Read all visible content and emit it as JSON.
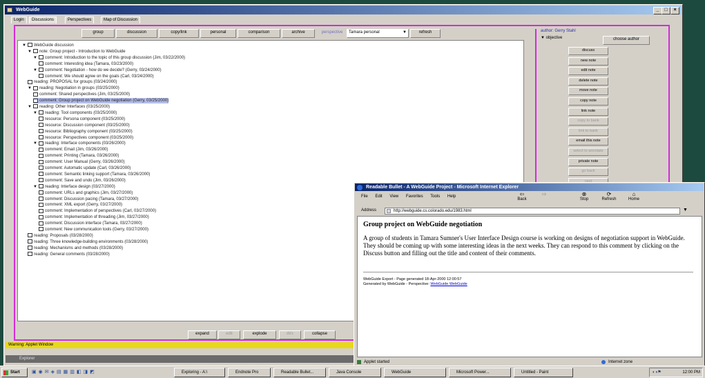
{
  "app_window": {
    "title": "WebGuide",
    "tabs": [
      "Login",
      "Discussions",
      "Perspectives",
      "Map of Discussion"
    ],
    "toolbar": {
      "buttons": [
        "group",
        "discussion",
        "copy/link",
        "personal",
        "comparison",
        "archive",
        "perspective"
      ],
      "perspective_value": "Tamara personal",
      "refresh_label": "refresh"
    },
    "tree": [
      {
        "indent": 0,
        "expander": "down",
        "text": "WebGuide discussion",
        "selected": false
      },
      {
        "indent": 1,
        "expander": "down",
        "text": "note: Group project - Introduction to WebGuide",
        "selected": false
      },
      {
        "indent": 2,
        "expander": "down",
        "text": "comment: Introduction to the topic of this group discussion (Jim, 03/22/2000)",
        "selected": false
      },
      {
        "indent": 3,
        "expander": "",
        "text": "comment: Interesting idea (Tamara, 03/23/2000)",
        "selected": false
      },
      {
        "indent": 2,
        "expander": "down",
        "text": "comment: Negotiation - how do we decide? (Gerry, 03/24/2000)",
        "selected": false
      },
      {
        "indent": 3,
        "expander": "",
        "text": "comment: We should agree on the goals (Carl, 03/24/2000)",
        "selected": false
      },
      {
        "indent": 1,
        "expander": "",
        "text": "reading: PROPOSAL for groups (03/24/2000)",
        "selected": false
      },
      {
        "indent": 1,
        "expander": "down",
        "text": "reading: Negotiation in groups (03/25/2000)",
        "selected": false
      },
      {
        "indent": 2,
        "expander": "",
        "text": "comment: Shared perspectives (Jim, 03/25/2000)",
        "selected": false
      },
      {
        "indent": 2,
        "expander": "",
        "text": "comment: Group project on WebGuide negotiation (Gerry, 03/25/2000)",
        "selected": true
      },
      {
        "indent": 1,
        "expander": "down",
        "text": "reading: Other Interfaces (03/25/2000)",
        "selected": false
      },
      {
        "indent": 2,
        "expander": "down",
        "text": "reading: Tool components (03/25/2000)",
        "selected": false
      },
      {
        "indent": 3,
        "expander": "",
        "text": "resource: Persona component (03/25/2000)",
        "selected": false
      },
      {
        "indent": 3,
        "expander": "",
        "text": "resource: Discussion component (03/25/2000)",
        "selected": false
      },
      {
        "indent": 3,
        "expander": "",
        "text": "resource: Bibliography component (03/25/2000)",
        "selected": false
      },
      {
        "indent": 3,
        "expander": "",
        "text": "resource: Perspectives component (03/25/2000)",
        "selected": false
      },
      {
        "indent": 2,
        "expander": "down",
        "text": "reading: Interface components (03/26/2000)",
        "selected": false
      },
      {
        "indent": 3,
        "expander": "",
        "text": "comment: Email (Jim, 03/26/2000)",
        "selected": false
      },
      {
        "indent": 3,
        "expander": "",
        "text": "comment: Printing (Tamara, 03/26/2000)",
        "selected": false
      },
      {
        "indent": 3,
        "expander": "",
        "text": "comment: User Manual (Gerry, 03/26/2000)",
        "selected": false
      },
      {
        "indent": 3,
        "expander": "",
        "text": "comment: Automatic update (Carl, 03/26/2000)",
        "selected": false
      },
      {
        "indent": 3,
        "expander": "",
        "text": "comment: Semantic linking support (Tamara, 03/26/2000)",
        "selected": false
      },
      {
        "indent": 3,
        "expander": "",
        "text": "comment: Save and undo (Jim, 03/26/2000)",
        "selected": false
      },
      {
        "indent": 2,
        "expander": "down",
        "text": "reading: Interface design (03/27/2000)",
        "selected": false
      },
      {
        "indent": 3,
        "expander": "",
        "text": "comment: URLs and graphics (Jim, 03/27/2000)",
        "selected": false
      },
      {
        "indent": 3,
        "expander": "",
        "text": "comment: Discussion pacing (Tamara, 03/27/2000)",
        "selected": false
      },
      {
        "indent": 3,
        "expander": "",
        "text": "comment: XML export (Gerry, 03/27/2000)",
        "selected": false
      },
      {
        "indent": 3,
        "expander": "",
        "text": "comment: Implementation of perspectives (Carl, 03/27/2000)",
        "selected": false
      },
      {
        "indent": 3,
        "expander": "",
        "text": "comment: Implementation of threading (Jim, 03/27/2000)",
        "selected": false
      },
      {
        "indent": 3,
        "expander": "",
        "text": "comment: Discussion interface (Tamara, 03/27/2000)",
        "selected": false
      },
      {
        "indent": 3,
        "expander": "",
        "text": "comment: New communication tools (Gerry, 03/27/2000)",
        "selected": false
      },
      {
        "indent": 1,
        "expander": "",
        "text": "reading: Proposals (03/28/2000)",
        "selected": false
      },
      {
        "indent": 1,
        "expander": "",
        "text": "reading: Three knowledge-building environments (03/28/2000)",
        "selected": false
      },
      {
        "indent": 1,
        "expander": "",
        "text": "reading: Mechanisms and methods (03/28/2000)",
        "selected": false
      },
      {
        "indent": 1,
        "expander": "",
        "text": "reading: General comments (03/28/2000)",
        "selected": false
      }
    ],
    "bottom_buttons": [
      {
        "label": "expand",
        "enabled": true
      },
      {
        "label": "edit",
        "enabled": false
      },
      {
        "label": "explode",
        "enabled": true
      },
      {
        "label": "dirs",
        "enabled": false
      },
      {
        "label": "collapse",
        "enabled": true
      }
    ],
    "side_panel": {
      "author_label": "author: Gerry Stahl",
      "objective_label": "objective",
      "choose_label": "choose author",
      "buttons": [
        {
          "label": "discuss",
          "enabled": true
        },
        {
          "label": "new note",
          "enabled": true
        },
        {
          "label": "edit note",
          "enabled": true
        },
        {
          "label": "delete note",
          "enabled": true
        },
        {
          "label": "move note",
          "enabled": true
        },
        {
          "label": "copy note",
          "enabled": true
        },
        {
          "label": "link note",
          "enabled": true
        },
        {
          "label": "copy to bank",
          "enabled": false
        },
        {
          "label": "link to bank",
          "enabled": false
        },
        {
          "label": "email this note",
          "enabled": true
        },
        {
          "label": "select to annotate",
          "enabled": false
        },
        {
          "label": "private note",
          "enabled": true
        },
        {
          "label": "go back",
          "enabled": false
        },
        {
          "label": "next",
          "enabled": false
        }
      ]
    },
    "status_text": "Warning: Applet Window",
    "yellow_bar_text": ""
  },
  "ie_window": {
    "title": "Readable Bullet - A WebGuide Project - Microsoft Internet Explorer",
    "menu": [
      "File",
      "Edit",
      "View",
      "Favorites",
      "Tools",
      "Help"
    ],
    "nav_buttons": [
      "Back",
      "Forward",
      "Stop",
      "Refresh",
      "Home"
    ],
    "address_label": "Address",
    "address_value": "http://webguide.cs.colorado.edu/1983.html",
    "page_heading": "Group project on WebGuide negotiation",
    "page_body": "A group of students in Tamara Sumner's User Interface Design course is working on designs of negotiation support in WebGuide. They should be coming up with some interesting ideas in the next weeks. They can respond to this comment by clicking on the Discuss button and filling out the title and content of their comments.",
    "footer_line1": "WebGuide Export - Page generated 18-Apr-2000 12:00:57",
    "footer_line2_prefix": "Generated by WebGuide - Perspective: ",
    "footer_link": "WebGuide WebGuide",
    "status_left": "Applet started",
    "status_right": "Internet zone"
  },
  "applet_footer": "Explorer",
  "taskbar": {
    "start_label": "Start",
    "buttons": [
      "Exploring - A:\\",
      "Endnote Pro",
      "Readable Bullet...",
      "Java Console",
      "WebGuide",
      "Microsoft Power...",
      "Untitled - Paint"
    ],
    "clock": "12:00 PM"
  }
}
